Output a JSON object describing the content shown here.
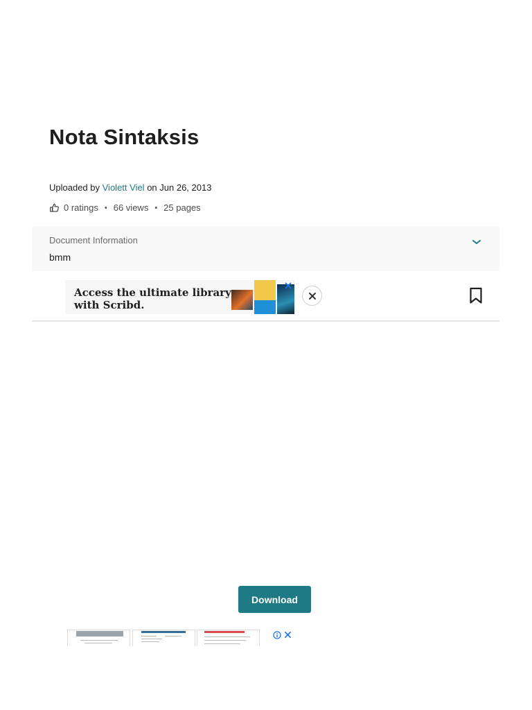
{
  "document": {
    "title": "Nota Sintaksis",
    "uploaded_prefix": "Uploaded by",
    "author": "Violett Viel",
    "uploaded_suffix": "on Jun 26, 2013",
    "ratings": "0 ratings",
    "views": "66 views",
    "pages": "25 pages",
    "separator": "•"
  },
  "document_info": {
    "label": "Document Information",
    "value": "bmm"
  },
  "ad": {
    "text_line1": "Access the ultimate library",
    "text_line2": "with Scribd."
  },
  "actions": {
    "download_label": "Download"
  },
  "colors": {
    "accent": "#1e7b85",
    "ad_choices": "#1a73e8"
  },
  "icons": {
    "ratings": "thumbs-up-icon",
    "expand": "chevron-down-icon",
    "close": "close-icon",
    "bookmark": "bookmark-icon",
    "ad_info": "info-icon"
  }
}
